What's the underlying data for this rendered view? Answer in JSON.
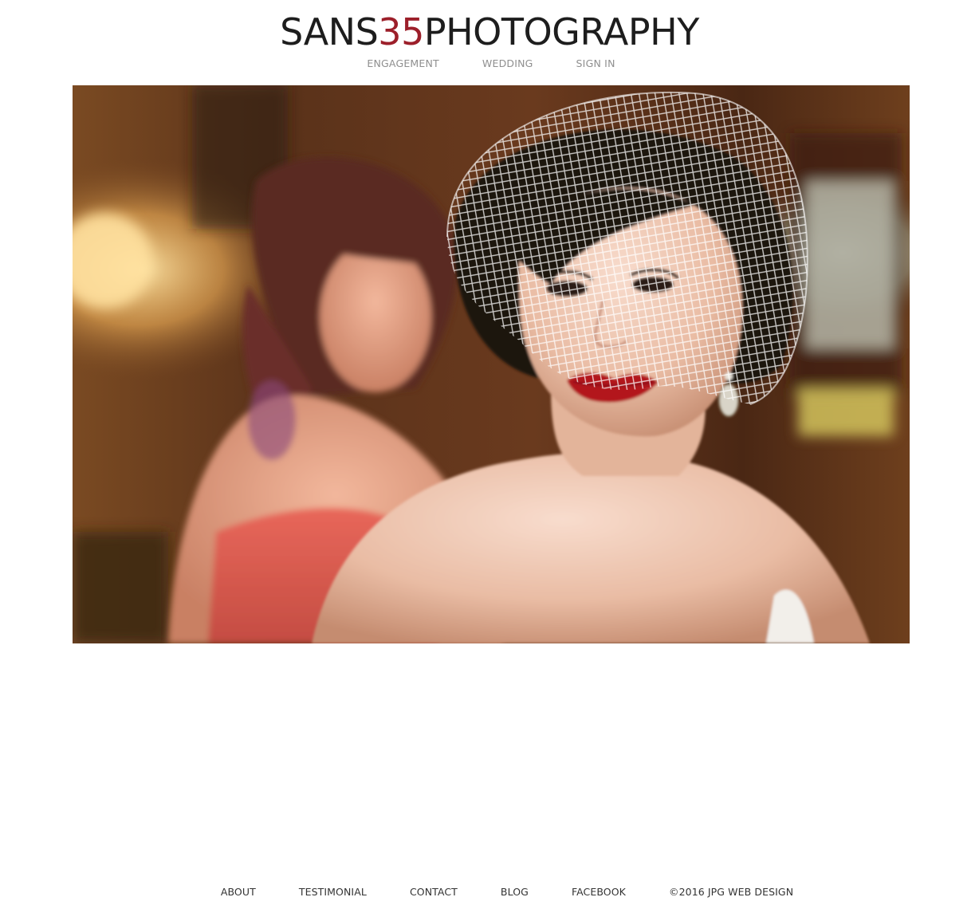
{
  "header": {
    "logo": {
      "part1": "SANS",
      "part2": "35",
      "part3": "PHOTOGRAPHY"
    },
    "nav": [
      {
        "label": "ENGAGEMENT"
      },
      {
        "label": "WEDDING"
      },
      {
        "label": "SIGN IN"
      }
    ]
  },
  "hero": {
    "alt": "Bride in birdcage veil with red lips; bridesmaid in coral dress behind her"
  },
  "footer": {
    "links": [
      {
        "label": "ABOUT"
      },
      {
        "label": "TESTIMONIAL"
      },
      {
        "label": "CONTACT"
      },
      {
        "label": "BLOG"
      },
      {
        "label": "FACEBOOK"
      }
    ],
    "copyright": "©2016 JPG WEB DESIGN"
  },
  "colors": {
    "accent": "#9c1f2a",
    "nav_text": "#8f8f8f",
    "footer_text": "#333333"
  }
}
